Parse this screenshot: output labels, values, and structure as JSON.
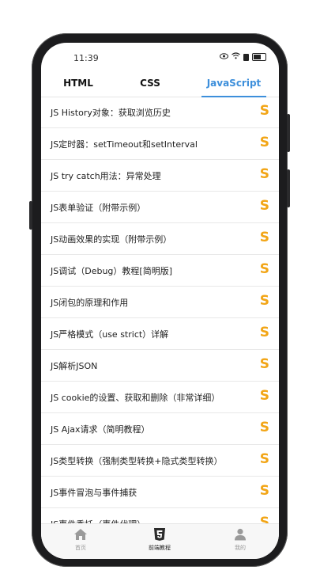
{
  "status_bar": {
    "time": "11:39"
  },
  "tabs": [
    {
      "label": "HTML",
      "active": false
    },
    {
      "label": "CSS",
      "active": false
    },
    {
      "label": "JavaScript",
      "active": true
    }
  ],
  "accent_color": "#3d8fdb",
  "row_icon_color": "#f2a516",
  "row_icon_glyph": "S",
  "list": [
    {
      "title": "JS History对象：获取浏览历史"
    },
    {
      "title": "JS定时器：setTimeout和setInterval"
    },
    {
      "title": "JS try catch用法：异常处理"
    },
    {
      "title": "JS表单验证（附带示例）"
    },
    {
      "title": "JS动画效果的实现（附带示例）"
    },
    {
      "title": "JS调试（Debug）教程[简明版]"
    },
    {
      "title": "JS闭包的原理和作用"
    },
    {
      "title": "JS严格模式（use strict）详解"
    },
    {
      "title": "JS解析JSON"
    },
    {
      "title": "JS cookie的设置、获取和删除（非常详细）"
    },
    {
      "title": "JS Ajax请求（简明教程）"
    },
    {
      "title": "JS类型转换（强制类型转换+隐式类型转换）"
    },
    {
      "title": "JS事件冒泡与事件捕获"
    },
    {
      "title": "JS事件委托（事件代理）"
    }
  ],
  "bottom_nav": [
    {
      "label": "首页",
      "icon": "home-icon",
      "active": false
    },
    {
      "label": "前端教程",
      "icon": "html5-icon",
      "active": true
    },
    {
      "label": "我的",
      "icon": "user-icon",
      "active": false
    }
  ]
}
